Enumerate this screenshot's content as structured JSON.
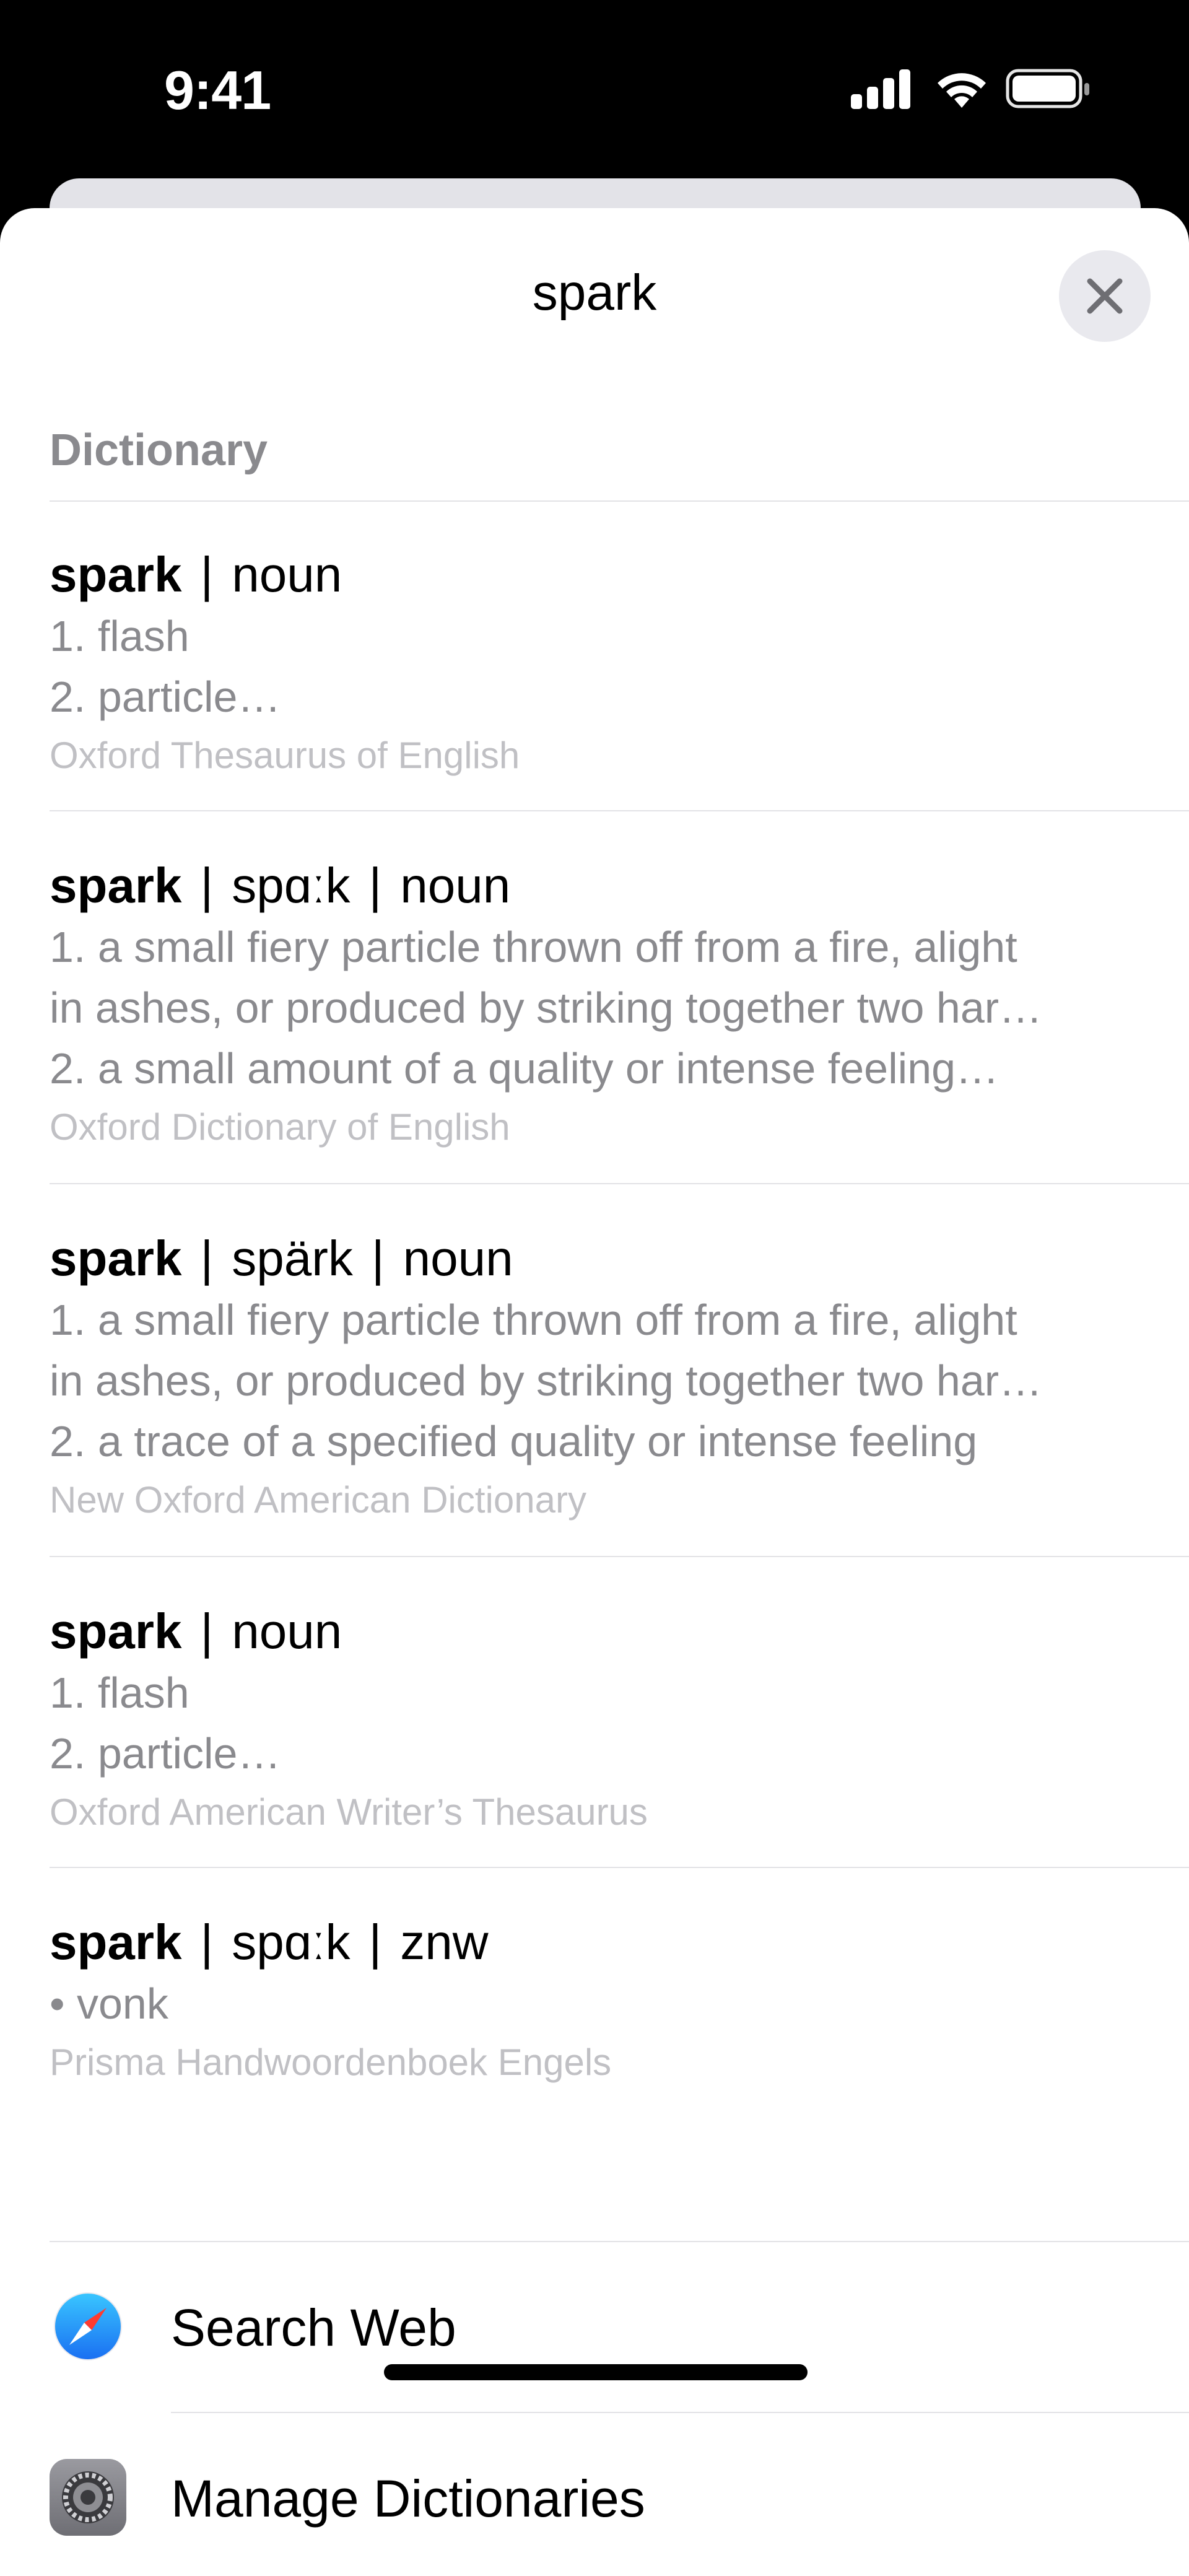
{
  "status_bar": {
    "time": "9:41",
    "icons": [
      "cellular-signal-icon",
      "wifi-icon",
      "battery-icon"
    ]
  },
  "sheet": {
    "title": "spark",
    "section_header": "Dictionary"
  },
  "entries": [
    {
      "word": "spark",
      "pronunciation": "",
      "pos": "noun",
      "lines": [
        "1. flash",
        "2. particle…"
      ],
      "source": "Oxford Thesaurus of English"
    },
    {
      "word": "spark",
      "pronunciation": "spɑːk",
      "pos": "noun",
      "lines": [
        "1. a small fiery particle thrown off from a fire, alight",
        "in ashes, or produced by striking together two har…",
        "2. a small amount of a quality or intense feeling…"
      ],
      "source": "Oxford Dictionary of English"
    },
    {
      "word": "spark",
      "pronunciation": "spärk",
      "pos": "noun",
      "lines": [
        "1. a small fiery particle thrown off from a fire, alight",
        "in ashes, or produced by striking together two har…",
        "2. a trace of a specified quality or intense feeling"
      ],
      "source": "New Oxford American Dictionary"
    },
    {
      "word": "spark",
      "pronunciation": "",
      "pos": "noun",
      "lines": [
        "1. flash",
        "2. particle…"
      ],
      "source": "Oxford American Writer’s Thesaurus"
    },
    {
      "word": "spark",
      "pronunciation": "spɑːk",
      "pos": "znw",
      "lines": [
        "• vonk"
      ],
      "source": "Prisma Handwoordenboek Engels"
    }
  ],
  "actions": [
    {
      "label": "Search Web",
      "icon": "safari-compass-icon"
    },
    {
      "label": "Manage Dictionaries",
      "icon": "settings-gear-icon"
    }
  ],
  "colors": {
    "secondary_text": "#8a8a8e",
    "tertiary_text": "#c0c0c4",
    "safari_blue": "#1a8cff",
    "settings_gray": "#8e8e93"
  }
}
